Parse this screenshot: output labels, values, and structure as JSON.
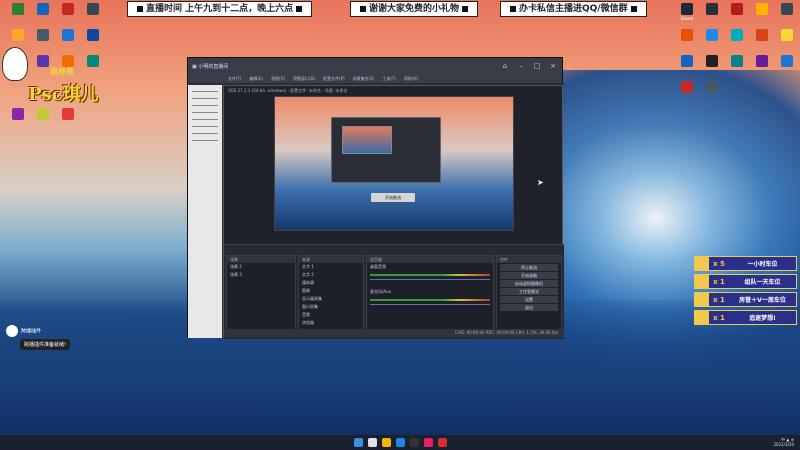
{
  "banners": [
    {
      "text": "直播时间 上午九到十二点，晚上六点"
    },
    {
      "text": "谢谢大家免费的小礼物"
    },
    {
      "text": "办卡私信主播进QQ/微信群"
    }
  ],
  "desktop": {
    "logo_top": "雨林兽",
    "logo_text": "Psc琪儿",
    "left_icons": [
      {
        "label": "",
        "color": "#2e7d32"
      },
      {
        "label": "",
        "color": "#1565c0"
      },
      {
        "label": "",
        "color": "#c62828"
      },
      {
        "label": "",
        "color": "#37474f"
      },
      {
        "label": "",
        "color": "#f9a825"
      },
      {
        "label": "",
        "color": "#455a64"
      },
      {
        "label": "",
        "color": "#1976d2"
      },
      {
        "label": "",
        "color": "#0d47a1"
      },
      {
        "label": "",
        "color": "#d32f2f"
      },
      {
        "label": "",
        "color": "#5e35b1"
      },
      {
        "label": "",
        "color": "#ef6c00"
      },
      {
        "label": "",
        "color": "#00897b"
      },
      {
        "label": "",
        "color": "#8e24aa"
      },
      {
        "label": "",
        "color": "#c0ca33"
      },
      {
        "label": "",
        "color": "#e53935"
      }
    ],
    "right_icons": [
      {
        "label": "Steam",
        "color": "#1b2838"
      },
      {
        "label": "",
        "color": "#263238"
      },
      {
        "label": "",
        "color": "#b71c1c"
      },
      {
        "label": "",
        "color": "#ffb300"
      },
      {
        "label": "",
        "color": "#37474f"
      },
      {
        "label": "",
        "color": "#e65100"
      },
      {
        "label": "",
        "color": "#1e88e5"
      },
      {
        "label": "",
        "color": "#00acc1"
      },
      {
        "label": "",
        "color": "#d84315"
      },
      {
        "label": "",
        "color": "#fdd835"
      },
      {
        "label": "",
        "color": "#1565c0"
      },
      {
        "label": "",
        "color": "#212121"
      },
      {
        "label": "",
        "color": "#00838f"
      },
      {
        "label": "",
        "color": "#6a1b9a"
      },
      {
        "label": "",
        "color": "#1976d2"
      },
      {
        "label": "",
        "color": "#c62828"
      },
      {
        "label": "",
        "color": "#455a64"
      }
    ]
  },
  "obs": {
    "window_title": "OBS 27.2.3 (64-bit, windows) - 配置文件: 未命名 - 场景: 未命名",
    "menu": [
      "文件(F)",
      "编辑(E)",
      "视图(V)",
      "停靠窗口(D)",
      "配置文件(P)",
      "场景集合(S)",
      "工具(T)",
      "帮助(H)"
    ],
    "start_stream_label": "开始推流",
    "docks": {
      "scenes_title": "场景",
      "scenes": [
        "场景 2",
        "场景 3"
      ],
      "sources_title": "来源",
      "sources": [
        "文字 1",
        "文字 2",
        "媒体源",
        "图像",
        "显示器采集",
        "窗口采集",
        "音频",
        "浏览器"
      ],
      "mixer_title": "混音器",
      "mixer": [
        "桌面音频",
        "麦克风/Aux"
      ],
      "controls_title": "控件",
      "controls": [
        "停止推流",
        "开始录制",
        "启动虚拟摄像机",
        "工作室模式",
        "设置",
        "退出"
      ]
    },
    "status": "LIVE: 00:00:00  REC: 00:00:00  CPU: 1.5%, 30.00 fps"
  },
  "tasks": [
    {
      "count": "x 5",
      "name": "一小时车位"
    },
    {
      "count": "x 1",
      "name": "组队一天车位"
    },
    {
      "count": "x 1",
      "name": "房管＋V一周车位"
    },
    {
      "count": "x 1",
      "name": "追逐梦想!"
    }
  ],
  "chat": {
    "user": "跨播插件",
    "message": "跨播插件准备就绪!"
  },
  "colors": {
    "task_border": "#f2c94c",
    "task_bg": "#2a2f8c",
    "obs_bg": "#2b2e38"
  }
}
